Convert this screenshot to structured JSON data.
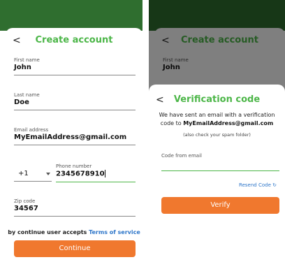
{
  "create": {
    "back_icon": "chevron-left-icon",
    "back_glyph": "<",
    "title": "Create account",
    "fields": {
      "first_name": {
        "label": "First name",
        "value": "John"
      },
      "last_name": {
        "label": "Last name",
        "value": "Doe"
      },
      "email": {
        "label": "Email address",
        "value": "MyEmailAddress@gmail.com"
      },
      "country_code": {
        "value": "+1"
      },
      "phone": {
        "label": "Phone number",
        "value": "2345678910"
      },
      "zip": {
        "label": "Zip code",
        "value": "34567"
      }
    },
    "terms_prefix": "by continue user accepts",
    "terms_link": "Terms of service",
    "continue_label": "Continue"
  },
  "verify": {
    "bg_title": "Create account",
    "bg_first_label": "First name",
    "bg_first_value": "John",
    "back_glyph": "<",
    "title": "Verification code",
    "message_line1": "We have sent an email with a verification",
    "message_line2_prefix": "code to",
    "message_email": "MyEmailAddress@gmail.com",
    "spam_note": "(also check your spam folder)",
    "code_label": "Code from email",
    "code_value": "",
    "resend_label": "Resend Code",
    "verify_label": "Verify"
  },
  "colors": {
    "brand_green": "#4cb648",
    "header_dark_green": "#2f6e2f",
    "accent_orange": "#f0782e",
    "link_blue": "#2e76c9"
  }
}
